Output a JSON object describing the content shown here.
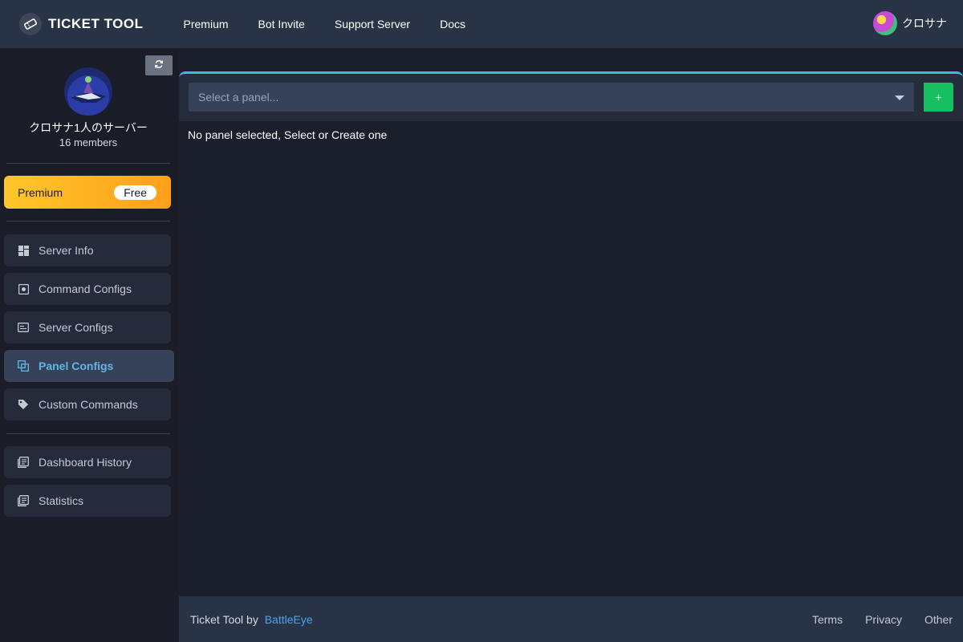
{
  "brand": {
    "name": "TICKET TOOL"
  },
  "nav": {
    "links": [
      "Premium",
      "Bot Invite",
      "Support Server",
      "Docs"
    ]
  },
  "user": {
    "name": "クロサナ"
  },
  "server": {
    "name": "クロサナ1人のサーバー",
    "members": "16 members"
  },
  "premium": {
    "label": "Premium",
    "badge": "Free"
  },
  "sidebar": {
    "items": [
      {
        "label": "Server Info",
        "icon": "dashboard-icon"
      },
      {
        "label": "Command Configs",
        "icon": "command-icon"
      },
      {
        "label": "Server Configs",
        "icon": "server-config-icon"
      },
      {
        "label": "Panel Configs",
        "icon": "panel-icon",
        "active": true
      },
      {
        "label": "Custom Commands",
        "icon": "tag-icon"
      },
      {
        "label": "Dashboard History",
        "icon": "history-icon"
      },
      {
        "label": "Statistics",
        "icon": "statistics-icon"
      }
    ]
  },
  "panel": {
    "select_placeholder": "Select a panel...",
    "add_label": "+",
    "empty_message": "No panel selected, Select or Create one"
  },
  "footer": {
    "prefix": "Ticket Tool by",
    "link": "BattleEye",
    "links": [
      "Terms",
      "Privacy",
      "Other"
    ]
  },
  "colors": {
    "accent": "#3fb5e0",
    "active_text": "#62b6e2",
    "add_button": "#16c060",
    "premium": "#ffb020"
  }
}
